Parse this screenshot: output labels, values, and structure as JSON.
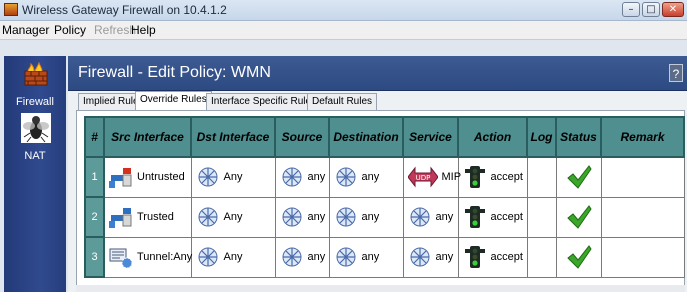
{
  "window": {
    "title": "Wireless Gateway Firewall on 10.4.1.2",
    "minimize": "–",
    "maximize": "□",
    "close": "✕"
  },
  "menu": {
    "manager": "Manager",
    "policy": "Policy",
    "refresh": "Refresh",
    "help": "Help"
  },
  "sidebar": [
    {
      "label": "Firewall",
      "icon": "firewall-icon"
    },
    {
      "label": "NAT",
      "icon": "nat-icon"
    }
  ],
  "header": {
    "title": "Firewall - Edit Policy: WMN",
    "help": "?"
  },
  "tabs": [
    "Implied Rules",
    "Override Rules",
    "Interface Specific Rules",
    "Default Rules"
  ],
  "active_tab": "Override Rules",
  "table": {
    "columns": [
      "#",
      "Src Interface",
      "Dst Interface",
      "Source",
      "Destination",
      "Service",
      "Action",
      "Log",
      "Status",
      "Remark"
    ],
    "rows": [
      {
        "num": "1",
        "src": "Untrusted",
        "dst": "Any",
        "source": "any",
        "destination": "any",
        "service": "MIP",
        "service_badge": "UDP",
        "action": "accept",
        "log": "",
        "status": "enabled",
        "remark": ""
      },
      {
        "num": "2",
        "src": "Trusted",
        "dst": "Any",
        "source": "any",
        "destination": "any",
        "service": "any",
        "service_badge": "",
        "action": "accept",
        "log": "",
        "status": "enabled",
        "remark": ""
      },
      {
        "num": "3",
        "src": "Tunnel:Any",
        "dst": "Any",
        "source": "any",
        "destination": "any",
        "service": "any",
        "service_badge": "",
        "action": "accept",
        "log": "",
        "status": "enabled",
        "remark": ""
      }
    ]
  },
  "colors": {
    "header_bg": "#2d4a82",
    "sidebar_bg": "#2f4a8e",
    "table_header": "#4f8f8f",
    "check": "#3aa62a"
  }
}
